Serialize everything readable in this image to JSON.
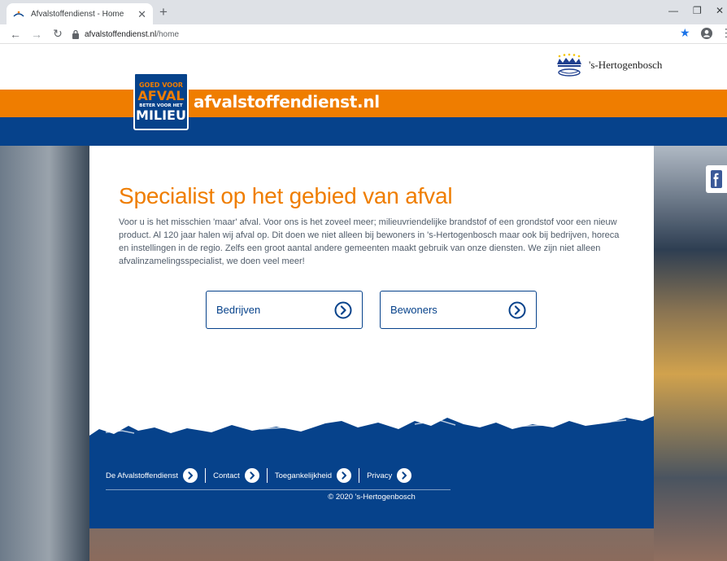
{
  "browser": {
    "tab_title": "Afvalstoffendienst - Home",
    "url_host": "afvalstoffendienst.nl",
    "url_path": "/home",
    "icons": [
      "favicon-icon",
      "close-icon",
      "plus-icon",
      "back-icon",
      "forward-icon",
      "reload-icon",
      "lock-icon",
      "star-icon",
      "profile-icon",
      "menu-icon",
      "minimize-icon",
      "restore-icon"
    ]
  },
  "header": {
    "logo_line1": "GOED VOOR",
    "logo_line2": "AFVAL",
    "logo_line3": "BETER VOOR HET",
    "logo_line4": "MILIEU",
    "site_name": "afvalstoffendienst.nl",
    "gemeente": "'s-Hertogenbosch"
  },
  "content": {
    "heading": "Specialist op het gebied van afval",
    "intro": "Voor u is het misschien 'maar' afval. Voor ons is het zoveel meer; milieuvriendelijke brandstof of een grondstof voor een nieuw product. Al 120 jaar halen wij afval op. Dit doen we niet alleen bij bewoners in 's-Hertogenbosch maar ook bij bedrijven, horeca en instellingen in de regio. Zelfs een groot aantal andere gemeenten maakt gebruik van onze diensten. We zijn niet alleen afvalinzamelingsspecialist, we doen veel meer!",
    "buttons": [
      {
        "label": "Bedrijven"
      },
      {
        "label": "Bewoners"
      }
    ]
  },
  "footer": {
    "links": [
      {
        "label": "De Afvalstoffendienst"
      },
      {
        "label": "Contact"
      },
      {
        "label": "Toegankelijkheid"
      },
      {
        "label": "Privacy"
      }
    ],
    "copyright": "© 2020 's-Hertogenbosch"
  },
  "colors": {
    "orange": "#ef7d00",
    "navy": "#06428b",
    "text": "#505c6a"
  }
}
